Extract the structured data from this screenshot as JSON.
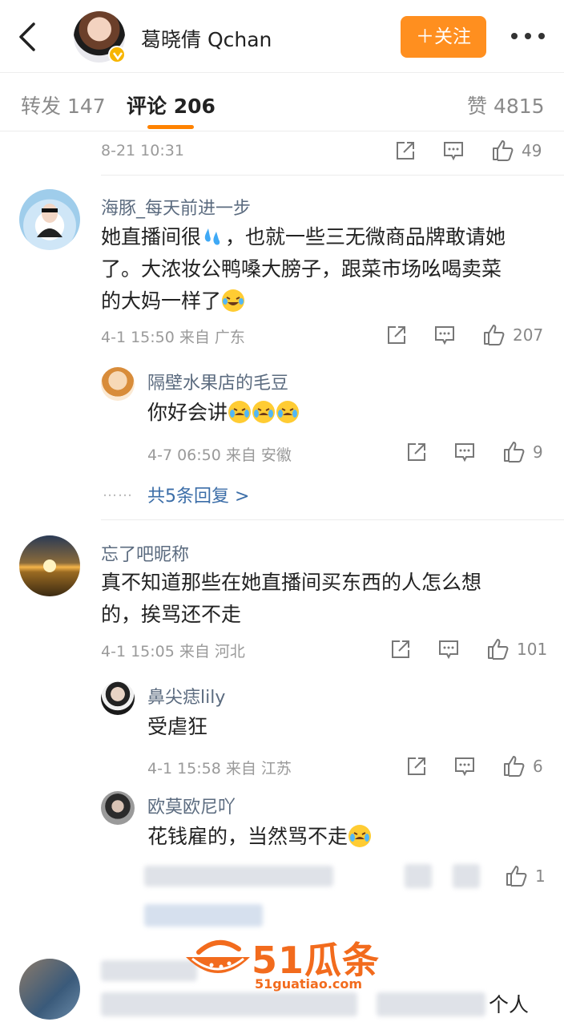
{
  "header": {
    "name": "葛晓倩 Qchan",
    "follow_label": "＋关注"
  },
  "tabs": {
    "repost": "转发 147",
    "comments": "评论 206",
    "likes": "赞 4815"
  },
  "top_meta": {
    "time": "8-21 10:31",
    "likes": "49"
  },
  "comments": [
    {
      "user": "海豚_每天前进一步",
      "text_line1": "她直播间很",
      "text_line1b": "，也就一些三无微商品牌敢请她",
      "text_line2": "了。大浓妆公鸭嗓大膀子，跟菜市场吆喝卖菜",
      "text_line3": "的大妈一样了",
      "meta": "4-1 15:50 来自 广东",
      "likes": "207",
      "replies": [
        {
          "user": "隔壁水果店的毛豆",
          "text": "你好会讲",
          "meta": "4-7 06:50 来自 安徽",
          "likes": "9"
        }
      ],
      "more_replies": "共5条回复 >",
      "dots": "……"
    },
    {
      "user": "忘了吧昵称",
      "text_line1": "真不知道那些在她直播间买东西的人怎么想",
      "text_line2": "的，挨骂还不走",
      "meta": "4-1 15:05 来自 河北",
      "likes": "101",
      "replies": [
        {
          "user": "鼻尖痣lily",
          "text": "受虐狂",
          "meta": "4-1 15:58 来自 江苏",
          "likes": "6"
        },
        {
          "user": "欧莫欧尼吖",
          "text": "花钱雇的，当然骂不走",
          "likes": "1"
        }
      ]
    }
  ],
  "tail_text": "个人",
  "watermark": {
    "main": "51瓜条",
    "sub": "51guatiao.com"
  }
}
